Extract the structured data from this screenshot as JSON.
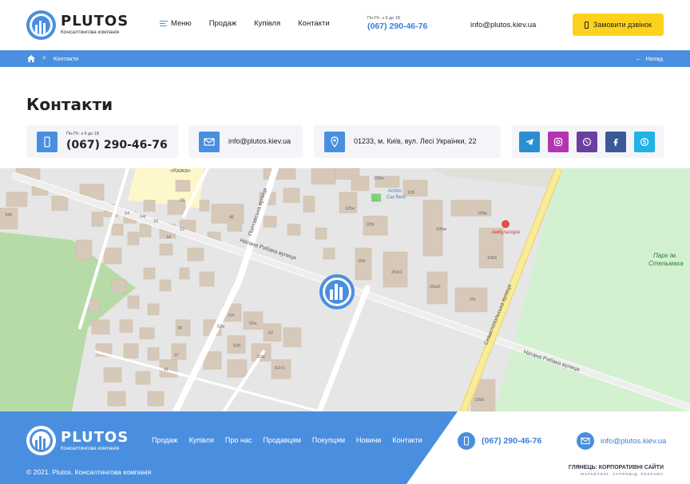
{
  "brand": {
    "name": "PLUTOS",
    "tagline": "Консалтингова компанія"
  },
  "nav": {
    "menu": "Меню",
    "sale": "Продаж",
    "purchase": "Купівля",
    "contacts": "Контакти"
  },
  "header_contact": {
    "hours": "Пн-Пт: з 9 до 18",
    "phone": "(067) 290-46-76",
    "email": "info@plutos.kiev.ua",
    "call_button": "Замовити дзвінок"
  },
  "breadcrumb": {
    "separator": ">",
    "current": "Контакти",
    "back": "Назад"
  },
  "page": {
    "title": "Контакти"
  },
  "cards": {
    "hours": "Пн-Пт: з 9 до 18",
    "phone": "(067) 290-46-76",
    "email": "info@plutos.kiev.ua",
    "address": "01233, м. Київ, вул. Лесі Українки, 22"
  },
  "social": [
    "telegram",
    "instagram",
    "viber",
    "facebook",
    "skype"
  ],
  "map": {
    "labels": {
      "kazka": "«Казка»",
      "poltavska": "Полтавська вулиця",
      "rybaka1": "Натана Рибака вулиця",
      "rybaka2": "Натана Рибака вулиця",
      "sevastopol": "Севастопольська вулиця",
      "park": "Парк ім.",
      "park2": "Стельмаха",
      "action": "Action",
      "carrent": "Car Rent",
      "ambul": "Амбулаторія"
    },
    "house_numbers": [
      "34б",
      "23",
      "14",
      "14г",
      "16",
      "18",
      "12",
      "45",
      "105а",
      "105",
      "105е",
      "105г",
      "105м",
      "105е",
      "105б",
      "25б",
      "25б/1",
      "25в/2",
      "25г",
      "62г",
      "62а",
      "62в",
      "62б",
      "62",
      "62ж",
      "62г/1",
      "39",
      "37",
      "41",
      "105б"
    ]
  },
  "footer": {
    "nav": [
      "Продаж",
      "Купівля",
      "Про нас",
      "Продавцям",
      "Покупцям",
      "Новини",
      "Контакти"
    ],
    "phone": "(067) 290-46-76",
    "email": "info@plutos.kiev.ua",
    "copyright": "© 2021. Plutos. Консалтингова компанія",
    "dev_title": "ГЛЯНЕЦЬ: КОРПОРАТИВНІ САЙТИ",
    "dev_sub": "МАРКЕТИНГ, СУПРОВІД, РЕКЛАМА"
  },
  "colors": {
    "primary": "#4a8fdf",
    "accent": "#fdd21f",
    "telegram": "#2a8fd0",
    "instagram": "#b435b0",
    "viber": "#6b3fa0",
    "facebook": "#3b5998",
    "skype": "#1fb3e8"
  }
}
